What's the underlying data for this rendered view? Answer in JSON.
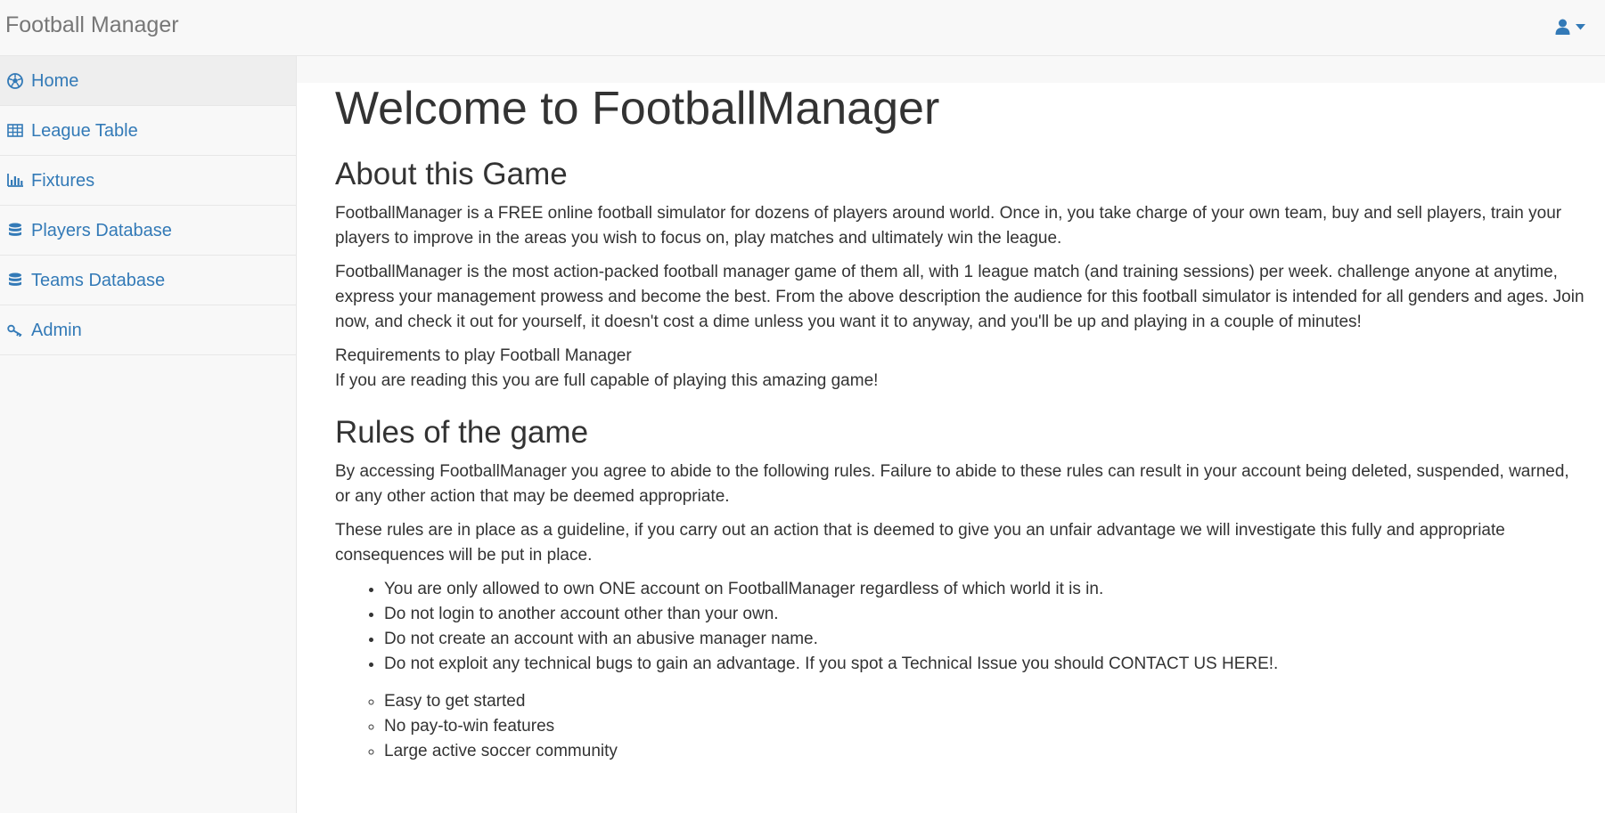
{
  "app": {
    "brand": "Football Manager"
  },
  "user_menu": {
    "icon": "user-icon",
    "caret": "caret-down-icon"
  },
  "sidebar": {
    "items": [
      {
        "label": "Home",
        "icon": "soccer-ball-icon",
        "active": true
      },
      {
        "label": "League Table",
        "icon": "table-icon",
        "active": false
      },
      {
        "label": "Fixtures",
        "icon": "bar-chart-icon",
        "active": false
      },
      {
        "label": "Players Database",
        "icon": "database-icon",
        "active": false
      },
      {
        "label": "Teams Database",
        "icon": "database-icon",
        "active": false
      },
      {
        "label": "Admin",
        "icon": "key-icon",
        "active": false
      }
    ]
  },
  "main": {
    "title": "Welcome to FootballManager",
    "about": {
      "heading": "About this Game",
      "paragraphs": [
        "FootballManager is a FREE online football simulator for dozens of players around world. Once in, you take charge of your own team, buy and sell players, train your players to improve in the areas you wish to focus on, play matches and ultimately win the league.",
        "FootballManager is the most action-packed football manager game of them all, with 1 league match (and training sessions) per week. challenge anyone at anytime, express your management prowess and become the best. From the above description the audience for this football simulator is intended for all genders and ages. Join now, and check it out for yourself, it doesn't cost a dime unless you want it to anyway, and you'll be up and playing in a couple of minutes!"
      ],
      "requirements_title": "Requirements to play Football Manager",
      "requirements_text": "If you are reading this you are full capable of playing this amazing game!"
    },
    "rules": {
      "heading": "Rules of the game",
      "paragraphs": [
        "By accessing FootballManager you agree to abide to the following rules. Failure to abide to these rules can result in your account being deleted, suspended, warned, or any other action that may be deemed appropriate.",
        "These rules are in place as a guideline, if you carry out an action that is deemed to give you an unfair advantage we will investigate this fully and appropriate consequences will be put in place."
      ],
      "list": [
        "You are only allowed to own ONE account on FootballManager regardless of which world it is in.",
        "Do not login to another account other than your own.",
        "Do not create an account with an abusive manager name.",
        "Do not exploit any technical bugs to gain an advantage. If you spot a Technical Issue you should CONTACT US HERE!."
      ],
      "features": [
        "Easy to get started",
        "No pay-to-win features",
        "Large active soccer community"
      ]
    }
  },
  "colors": {
    "link": "#337ab7",
    "text": "#333333",
    "brand": "#777777",
    "navbar_bg": "#f8f8f8",
    "active_bg": "#eeeeee"
  }
}
